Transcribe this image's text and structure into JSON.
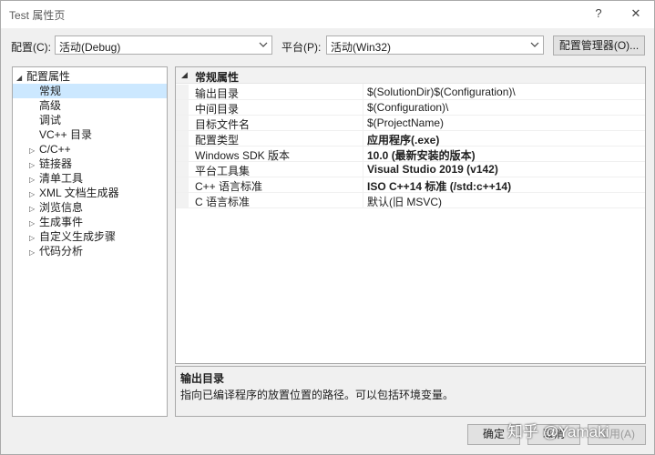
{
  "window": {
    "title": "Test 属性页",
    "help_glyph": "?",
    "close_glyph": "✕"
  },
  "config_bar": {
    "config_label": "配置(C):",
    "config_value": "活动(Debug)",
    "platform_label": "平台(P):",
    "platform_value": "活动(Win32)",
    "manager_button": "配置管理器(O)..."
  },
  "tree": {
    "items": [
      {
        "label": "配置属性",
        "expander": "◢",
        "indent": 0
      },
      {
        "label": "常规",
        "expander": "",
        "indent": 1,
        "selected": true
      },
      {
        "label": "高级",
        "expander": "",
        "indent": 1
      },
      {
        "label": "调试",
        "expander": "",
        "indent": 1
      },
      {
        "label": "VC++ 目录",
        "expander": "",
        "indent": 1
      },
      {
        "label": "C/C++",
        "expander": "▷",
        "indent": 1
      },
      {
        "label": "链接器",
        "expander": "▷",
        "indent": 1
      },
      {
        "label": "清单工具",
        "expander": "▷",
        "indent": 1
      },
      {
        "label": "XML 文档生成器",
        "expander": "▷",
        "indent": 1
      },
      {
        "label": "浏览信息",
        "expander": "▷",
        "indent": 1
      },
      {
        "label": "生成事件",
        "expander": "▷",
        "indent": 1
      },
      {
        "label": "自定义生成步骤",
        "expander": "▷",
        "indent": 1
      },
      {
        "label": "代码分析",
        "expander": "▷",
        "indent": 1
      }
    ]
  },
  "grid": {
    "section_title": "常规属性",
    "section_expander": "◢",
    "rows": [
      {
        "name": "输出目录",
        "value": "$(SolutionDir)$(Configuration)\\",
        "bold": false
      },
      {
        "name": "中间目录",
        "value": "$(Configuration)\\",
        "bold": false
      },
      {
        "name": "目标文件名",
        "value": "$(ProjectName)",
        "bold": false
      },
      {
        "name": "配置类型",
        "value": "应用程序(.exe)",
        "bold": true
      },
      {
        "name": "Windows SDK 版本",
        "value": "10.0 (最新安装的版本)",
        "bold": true
      },
      {
        "name": "平台工具集",
        "value": "Visual Studio 2019 (v142)",
        "bold": true
      },
      {
        "name": "C++ 语言标准",
        "value": "ISO C++14 标准 (/std:c++14)",
        "bold": true
      },
      {
        "name": "C 语言标准",
        "value": "默认(旧 MSVC)",
        "bold": false
      }
    ]
  },
  "description": {
    "title": "输出目录",
    "text": "指向已编译程序的放置位置的路径。可以包括环境变量。"
  },
  "buttons": {
    "ok": "确定",
    "cancel": "取消",
    "apply": "应用(A)"
  },
  "watermark": "知乎 @Yamaki"
}
